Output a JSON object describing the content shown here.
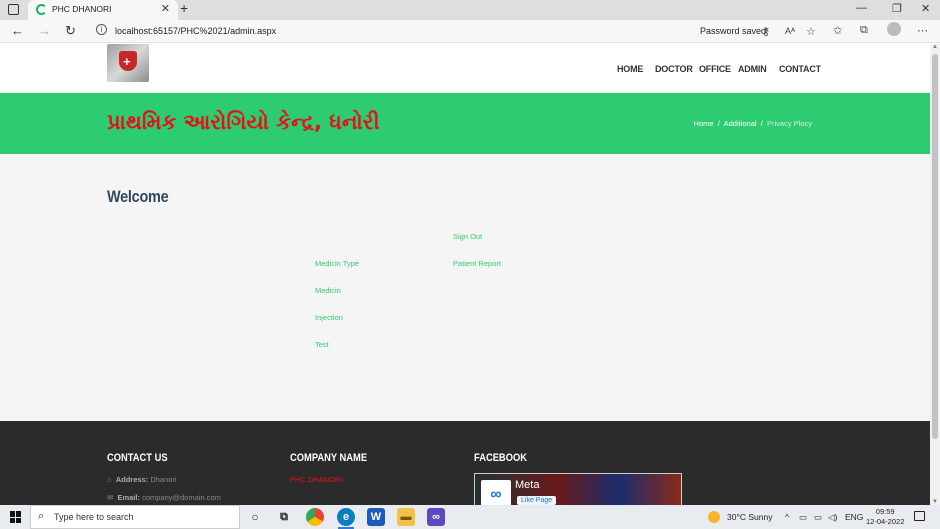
{
  "browser": {
    "tab_title": "PHC DHANORI",
    "url": "localhost:65157/PHC%2021/admin.aspx",
    "password_saved": "Password saved"
  },
  "site": {
    "nav": [
      "HOME",
      "DOCTOR",
      "OFFICE",
      "ADMIN",
      "CONTACT"
    ],
    "banner_title": "પ્રાથમિક આરોગિયો કેન્દ્ર, ધનોરી",
    "breadcrumb": {
      "home": "Home",
      "sep": "/",
      "additional": "Additional",
      "current": "Privacy Plocy"
    },
    "welcome": "Welcome",
    "admin_links": {
      "sign_out": "Sign Out",
      "medicin_type": "Medicin Type",
      "patient_report": "Patient Report",
      "medicin": "Medicin",
      "injection": "Injection",
      "test": "Test"
    },
    "footer": {
      "contact_heading": "CONTACT US",
      "address_label": "Address:",
      "address_value": "Dhanori",
      "email_label": "Email:",
      "email_value": "company@domain.com",
      "company_heading": "COMPANY NAME",
      "company_value": "PHC DHANORI",
      "facebook_heading": "FACEBOOK",
      "fb_page_name": "Meta",
      "fb_like": "Like Page"
    }
  },
  "taskbar": {
    "search_placeholder": "Type here to search",
    "weather": "30°C  Sunny",
    "lang": "ENG",
    "time": "09:59",
    "date": "12-04-2022"
  },
  "colors": {
    "accent_green": "#2ecc71",
    "title_red": "#e3131b",
    "footer_bg": "#2b2b2b"
  }
}
